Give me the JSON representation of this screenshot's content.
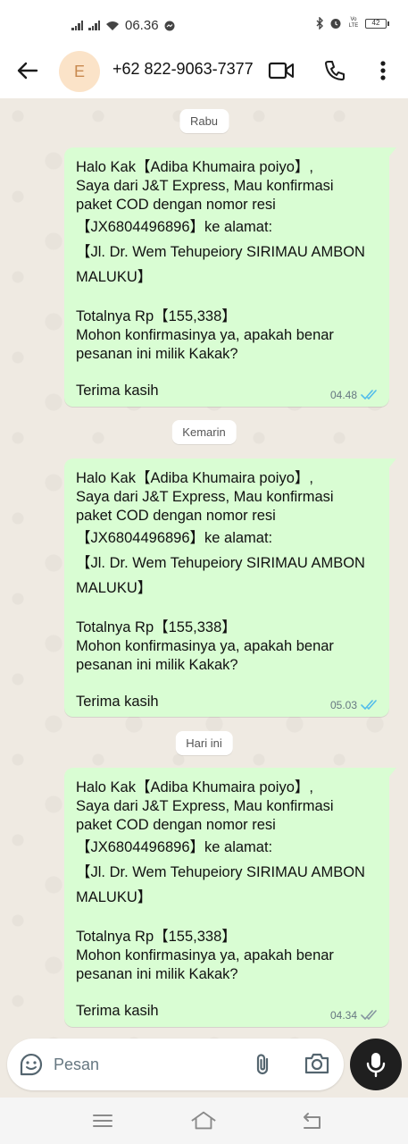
{
  "status_bar": {
    "time": "06.36",
    "network_label": "Vo LTE",
    "battery": "42"
  },
  "header": {
    "avatar_letter": "E",
    "contact": "+62 822-9063-7377",
    "back_icon": "arrow-left-icon",
    "video_icon": "video-camera-icon",
    "call_icon": "phone-icon",
    "menu_icon": "more-vertical-icon"
  },
  "chat": {
    "messages": [
      {
        "date": "Rabu",
        "lines": [
          "Halo Kak【Adiba Khumaira poiyo】,",
          "Saya dari J&T Express, Mau konfirmasi",
          "paket COD dengan nomor resi",
          "【JX6804496896】ke alamat:",
          "【Jl. Dr. Wem Tehupeiory  SIRIMAU AMBON",
          "MALUKU】",
          "Totalnya Rp【155,338】",
          "Mohon konfirmasinya ya, apakah benar",
          "pesanan ini milik Kakak?",
          "Terima kasih"
        ],
        "time": "04.48",
        "status": "read"
      },
      {
        "date": "Kemarin",
        "lines": [
          "Halo Kak【Adiba Khumaira poiyo】,",
          "Saya dari J&T Express, Mau konfirmasi",
          "paket COD dengan nomor resi",
          "【JX6804496896】ke alamat:",
          "【Jl. Dr. Wem Tehupeiory  SIRIMAU AMBON",
          "MALUKU】",
          "Totalnya Rp【155,338】",
          "Mohon konfirmasinya ya, apakah benar",
          "pesanan ini milik Kakak?",
          "Terima kasih"
        ],
        "time": "05.03",
        "status": "read"
      },
      {
        "date": "Hari ini",
        "lines": [
          "Halo Kak【Adiba Khumaira poiyo】,",
          "Saya dari J&T Express, Mau konfirmasi",
          "paket COD dengan nomor resi",
          "【JX6804496896】ke alamat:",
          "【Jl. Dr. Wem Tehupeiory  SIRIMAU AMBON",
          "MALUKU】",
          "Totalnya Rp【155,338】",
          "Mohon konfirmasinya ya, apakah benar",
          "pesanan ini milik Kakak?",
          "Terima kasih"
        ],
        "time": "04.34",
        "status": "delivered"
      }
    ]
  },
  "composer": {
    "placeholder": "Pesan",
    "emoji_icon": "sticker-icon",
    "attach_icon": "paperclip-icon",
    "camera_icon": "camera-icon",
    "mic_icon": "microphone-icon"
  },
  "colors": {
    "outgoing_bubble": "#d9fdd3",
    "read_tick": "#53bdeb",
    "delivered_tick": "#8696a0",
    "chat_background": "#efeae2"
  }
}
